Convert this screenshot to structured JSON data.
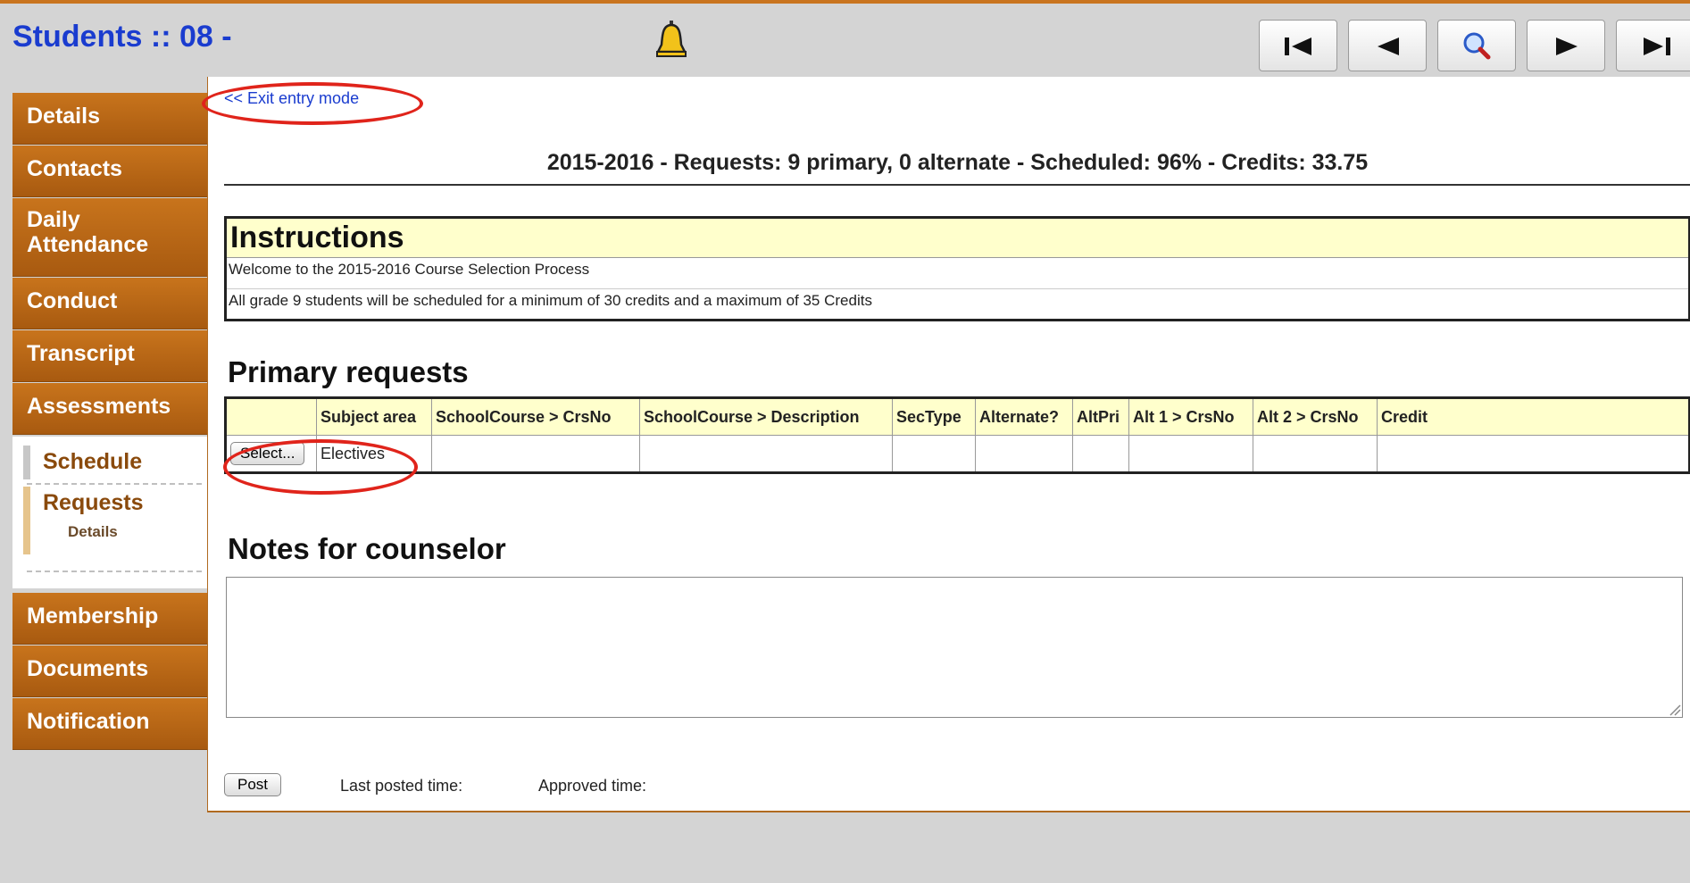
{
  "header": {
    "title": "Students :: 08 -",
    "nav": [
      "first-record-icon",
      "previous-record-icon",
      "search-icon",
      "next-record-icon",
      "last-record-icon"
    ]
  },
  "sidebar": {
    "tabs": [
      {
        "label": "Details"
      },
      {
        "label": "Contacts"
      },
      {
        "label": "Daily Attendance"
      },
      {
        "label": "Conduct"
      },
      {
        "label": "Transcript"
      },
      {
        "label": "Assessments"
      }
    ],
    "schedule_label": "Schedule",
    "requests_label": "Requests",
    "requests_details_label": "Details",
    "bottom_tabs": [
      {
        "label": "Membership"
      },
      {
        "label": "Documents"
      },
      {
        "label": "Notification"
      }
    ]
  },
  "main": {
    "exit_link": "<< Exit entry mode",
    "summary": "2015-2016 - Requests: 9 primary, 0 alternate - Scheduled: 96% - Credits: 33.75",
    "instructions": {
      "heading": "Instructions",
      "lines": [
        "Welcome to the 2015-2016 Course Selection Process",
        "All grade 9 students will be scheduled for a minimum of 30 credits and a maximum of 35 Credits"
      ]
    },
    "primary_heading": "Primary requests",
    "table": {
      "headers": [
        "",
        "Subject area",
        "SchoolCourse > CrsNo",
        "SchoolCourse > Description",
        "SecType",
        "Alternate?",
        "AltPri",
        "Alt 1 > CrsNo",
        "Alt 2 > CrsNo",
        "Credit"
      ],
      "rows": [
        {
          "select_label": "Select...",
          "subject_area": "Electives"
        }
      ]
    },
    "notes_heading": "Notes for counselor",
    "notes_value": "",
    "post_label": "Post",
    "last_posted_label": "Last posted time:",
    "approved_label": "Approved time:"
  },
  "colors": {
    "title_blue": "#1a3ccf",
    "tab_orange": "#c8741c",
    "highlight_yellow": "#ffffcc",
    "annotation_red": "#e0241b"
  }
}
